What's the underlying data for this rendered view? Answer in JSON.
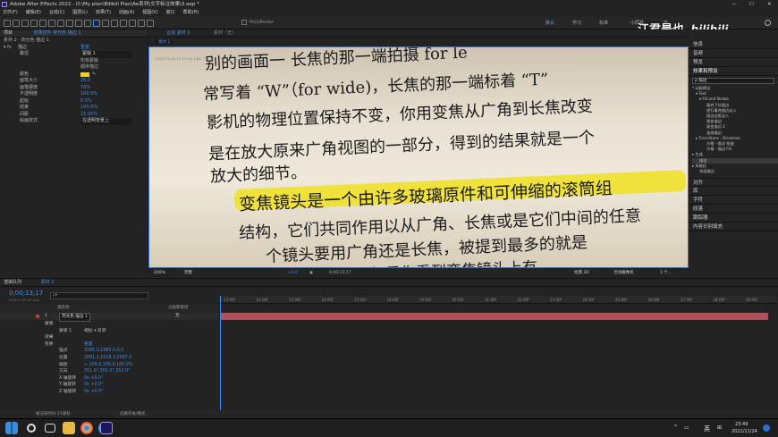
{
  "window": {
    "title": "Adobe After Effects 2022 - D:\\My plan\\Bilibili Plan\\Ae系列\\文字标注效果\\3.aep *",
    "min": "—",
    "max": "☐",
    "close": "✕"
  },
  "menu": [
    "文件(F)",
    "编辑(E)",
    "合成(C)",
    "图层(L)",
    "效果(T)",
    "动画(A)",
    "视图(V)",
    "窗口",
    "帮助(H)"
  ],
  "toolbar": {
    "rotobrush": "RotoBezier",
    "workspaces": [
      "默认",
      "学习",
      "标准",
      "小屏幕",
      "库"
    ],
    "search_icon": "search-icon"
  },
  "watermark": {
    "name": "江君是也",
    "logo": "bilibili"
  },
  "effect_controls": {
    "tab_project": "项目",
    "tab_effects": "效果控件 荧光色 描边 1",
    "layer_path": "素材 2 · 荧光色 描边 1",
    "effect_name": "描边",
    "reset": "重置",
    "path_label": "路径",
    "path_value": "蒙版 1",
    "all_masks": "所有蒙版",
    "sequential": "顺序描边",
    "rows": [
      {
        "l": "颜色",
        "v": ""
      },
      {
        "l": "画笔大小",
        "v": "26.0"
      },
      {
        "l": "画笔硬度",
        "v": "70%"
      },
      {
        "l": "不透明度",
        "v": "100.0%"
      },
      {
        "l": "起始",
        "v": "0.0%"
      },
      {
        "l": "结束",
        "v": "100.0%"
      },
      {
        "l": "间距",
        "v": "15.00%"
      },
      {
        "l": "绘画样式",
        "v": "在透明背景上"
      }
    ],
    "color": "#f2d21f"
  },
  "composition": {
    "tab": "合成 素材 2",
    "tab2": "素材（无）",
    "sub_tab": "素材 2",
    "timestamp": "2021/11/24 11:20:00 14/0.7 s",
    "zoom": "200%",
    "quality": "完整",
    "time": "0;00;13;17",
    "offset": "+0.0",
    "view": "经典 3D",
    "camera": "活动摄像机",
    "views": "1 个..."
  },
  "photo": {
    "l1": "别的画面一        长焦的那一端拍摄      for le",
    "l2": "常写着 “W”（for wide)，长焦的那一端标着 “T”",
    "l3": "影机的物理位置保持不变，你用变焦从广角到长焦改变",
    "l4": "影机的物理位置保持不变，你用变焦从广角到长焦改变",
    "l5": "是在放大原来广角视图的一部分，得到的结果就是一个",
    "l6": "放大的细节。",
    "l7": "变焦镜头是一个由许多玻璃原件和可伸缩的滚筒组",
    "l8": "结构，它们共同作用以从广角、长焦或是它们中间的任意",
    "l9": "个镜头要用广角还是长焦，被提到最多的就是",
    "l10": "但如果你看到变焦镜头上有"
  },
  "right_panel": {
    "info": "信息",
    "audio": "音频",
    "preview": "预览",
    "effects_presets": "效果和预设",
    "search": "描边",
    "tree": [
      "* 动画预设",
      "  ▾ Text",
      "    ▾ Fill and Stroke",
      "        填充下拉描边",
      "        逐行填充描边淡入",
      "        描边边框淡入",
      "        渐变描边",
      "        渐变描边 2",
      "        竖线描边",
      "  ▸ Transitions - Dissolves",
      "        方格 - 描边 扭曲",
      "        方格 - 描边 Fill",
      "▸ 生成",
      "  描边",
      "▸ 风格化",
      "  涂画描边"
    ],
    "sections": [
      "对齐",
      "库",
      "字符",
      "段落",
      "跟踪器",
      "内容识别填充"
    ]
  },
  "timeline": {
    "tab_render": "渲染队列",
    "tab_comp": "素材 2",
    "time": "0;00;13;17",
    "fps": "00407 (29.97 fps)",
    "search_placeholder": "ρ▾",
    "col_source": "源名称",
    "col_parent": "父级和链接",
    "parent_val": "无",
    "layer_num": "1",
    "layer_name": "荧光色 描边 1",
    "ticks": [
      "13:00f",
      "14:00f",
      "15:00f",
      "16:00f",
      "17:00f",
      "18:00f",
      "19:00f",
      "20:00f",
      "21:00f",
      "22:00f",
      "23:00f",
      "24:00f",
      "25:00f",
      "26:00f",
      "27:00f",
      "28:00f",
      "29:00f"
    ],
    "rows": [
      {
        "n": "蒙版",
        "v": "",
        "i": 50
      },
      {
        "n": "蒙版 1",
        "v": "相加 ▾  反转",
        "i": 60
      },
      {
        "n": "效果",
        "v": "",
        "i": 50
      },
      {
        "n": "变换",
        "v": "重置",
        "i": 50
      },
      {
        "n": "锚点",
        "v": "1085.0,1085.0,0.0",
        "i": 64
      },
      {
        "n": "位置",
        "v": "2061.1,1028.3,2097.0",
        "i": 64
      },
      {
        "n": "缩放",
        "v": "∞ 100.0,100.0,100.0%",
        "i": 64
      },
      {
        "n": "方向",
        "v": "351.0°,355.0°,352.0°",
        "i": 64
      },
      {
        "n": "X 轴旋转",
        "v": "0x +0.0°",
        "i": 64
      },
      {
        "n": "Y 轴旋转",
        "v": "0x +0.0°",
        "i": 64
      },
      {
        "n": "Z 轴旋转",
        "v": "0x +0.0°",
        "i": 64
      }
    ],
    "footer_time": "帧渲染时间 31毫秒",
    "footer_toggle": "切换开关/模式"
  },
  "taskbar": {
    "lang": "英",
    "time": "23:49",
    "date": "2021/11/24"
  }
}
